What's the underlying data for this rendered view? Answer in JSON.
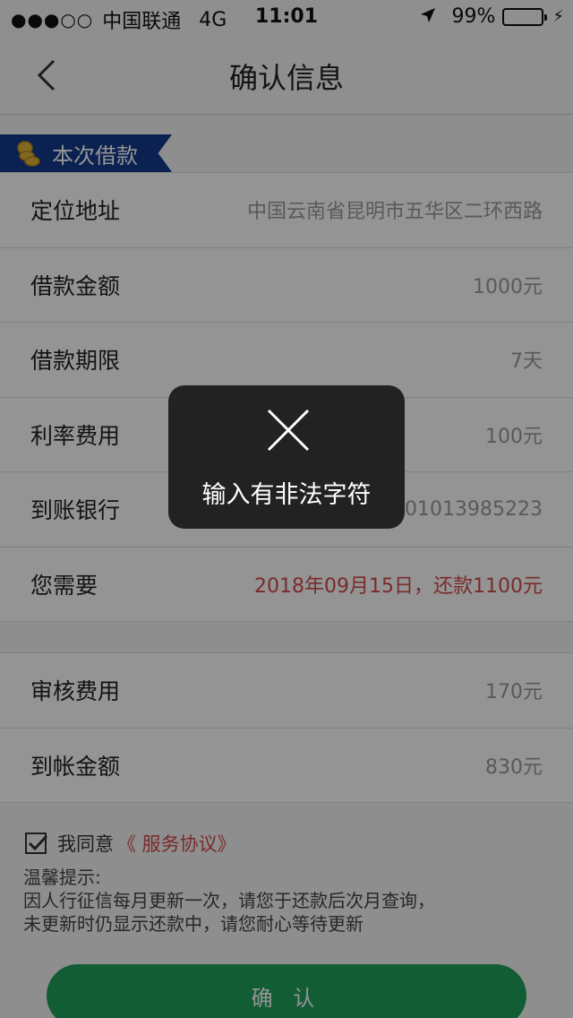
{
  "status_bar": {
    "signal": "●●●○○",
    "carrier": "中国联通",
    "network": "4G",
    "time": "11:01",
    "battery": "99%",
    "battery_level": 0.99
  },
  "nav": {
    "title": "确认信息",
    "back_icon": "chevron-left-icon"
  },
  "section": {
    "label": "本次借款",
    "icon": "coins-icon",
    "color": "#123a8c"
  },
  "rows": [
    {
      "label": "定位地址",
      "value": "中国云南省昆明市五华区二环西路"
    },
    {
      "label": "借款金额",
      "value": "1000元"
    },
    {
      "label": "借款期限",
      "value": "7天"
    },
    {
      "label": "利率费用",
      "value": "100元"
    },
    {
      "label": "到账银行",
      "value": "201013985223"
    },
    {
      "label": "您需要",
      "value": "2018年09月15日，还款1100元"
    }
  ],
  "fee_rows": [
    {
      "label": "审核费用",
      "value": "170元"
    },
    {
      "label": "到帐金额",
      "value": "830元"
    }
  ],
  "agreement": {
    "checked": true,
    "text": "我同意",
    "link": "《 服务协议》"
  },
  "tips": {
    "title": "温馨提示:",
    "line1": "因人行征信每月更新一次，请您于还款后次月查询，",
    "line2": "未更新时仍显示还款中，请您耐心等待更新"
  },
  "confirm_button": "确 认",
  "toast": {
    "icon": "close-icon",
    "message": "输入有非法字符"
  },
  "colors": {
    "accent_red": "#d24a4a",
    "button_green": "#1fa05a",
    "battery_green": "#4cd964"
  }
}
